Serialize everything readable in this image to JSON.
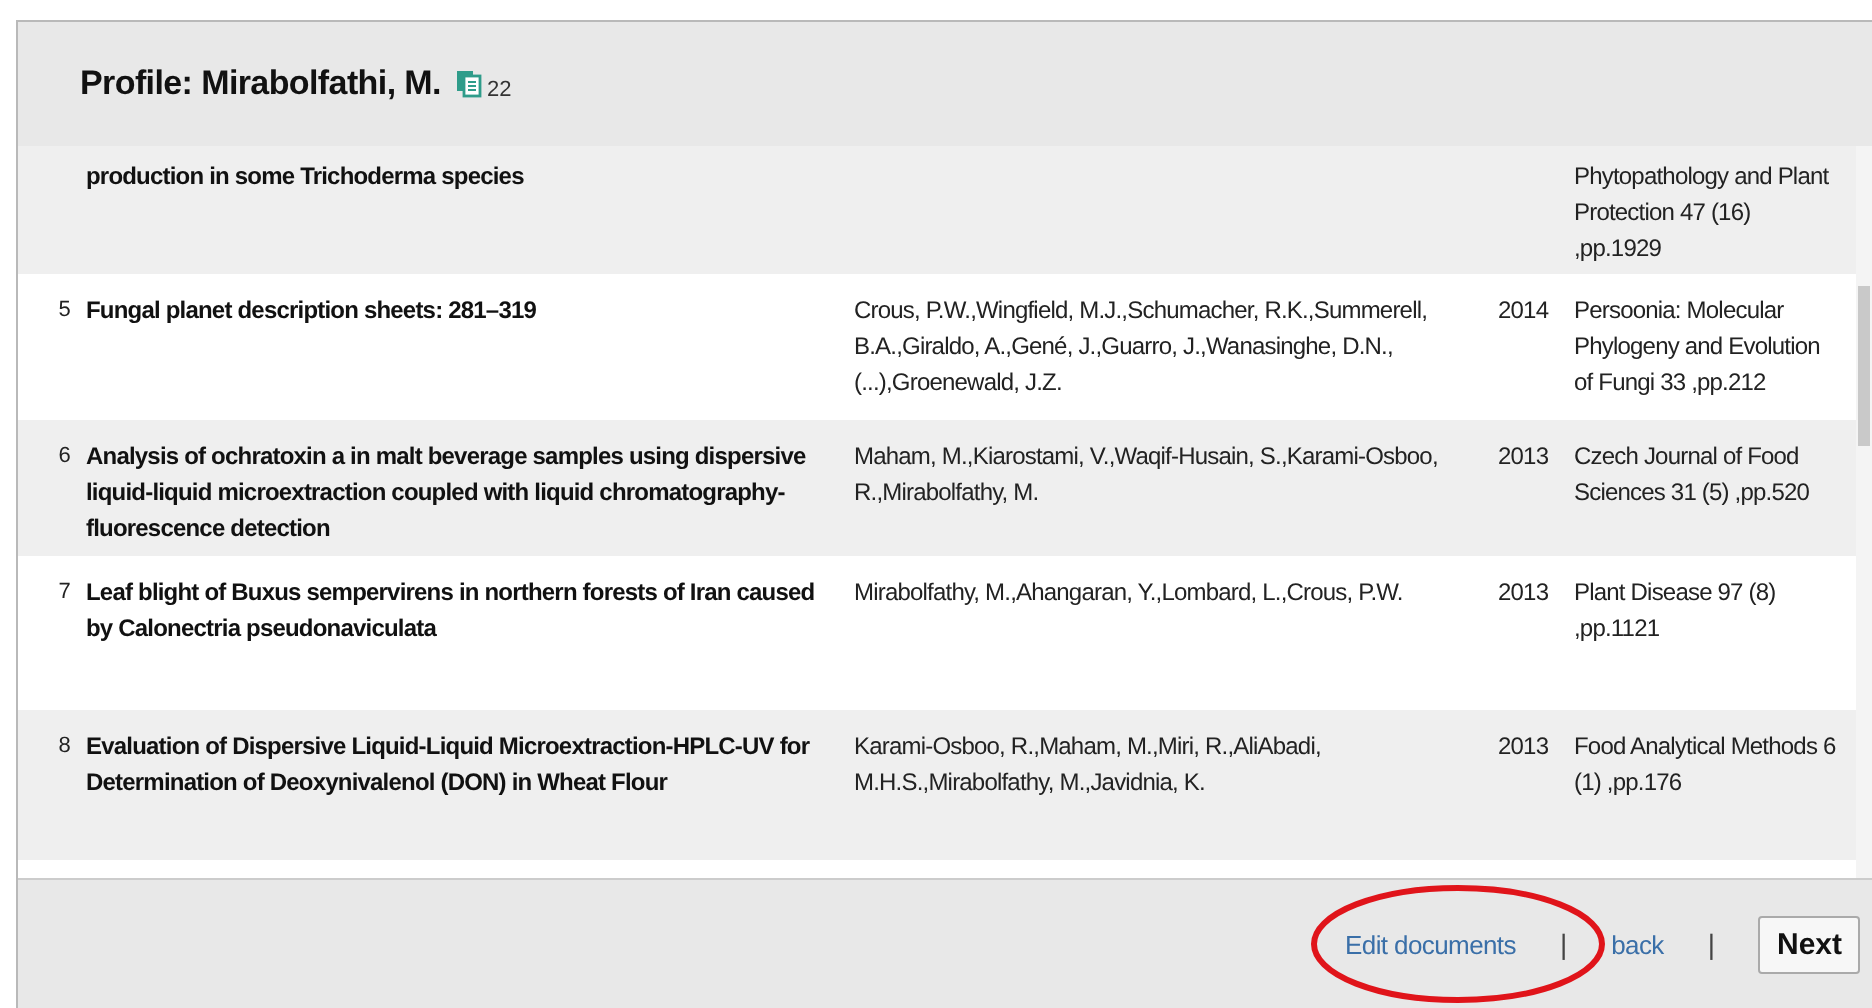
{
  "profile": {
    "title": "Profile: Mirabolfathi, M.",
    "document_count": "22"
  },
  "rows": [
    {
      "number": "",
      "title": "production in some Trichoderma species",
      "authors": "",
      "year": "",
      "source": "Phytopathology and Plant Protection 47 (16) ,pp.1929"
    },
    {
      "number": "5",
      "title": "Fungal planet description sheets: 281–319",
      "authors": "Crous, P.W.,Wingfield, M.J.,Schumacher, R.K.,Summerell, B.A.,Giraldo, A.,Gené, J.,Guarro, J.,Wanasinghe, D.N., (...),Groenewald, J.Z.",
      "year": "2014",
      "source": "Persoonia: Molecular Phylogeny and Evolution of Fungi 33 ,pp.212"
    },
    {
      "number": "6",
      "title": "Analysis of ochratoxin a in malt beverage samples using dispersive liquid-liquid microextraction coupled with liquid chromatography-fluorescence detection",
      "authors": "Maham, M.,Kiarostami, V.,Waqif-Husain, S.,Karami-Osboo, R.,Mirabolfathy, M.",
      "year": "2013",
      "source": "Czech Journal of Food Sciences 31 (5) ,pp.520"
    },
    {
      "number": "7",
      "title": "Leaf blight of Buxus sempervirens in northern forests of Iran caused by Calonectria pseudonaviculata",
      "authors": "Mirabolfathy, M.,Ahangaran, Y.,Lombard, L.,Crous, P.W.",
      "year": "2013",
      "source": "Plant Disease 97 (8) ,pp.1121"
    },
    {
      "number": "8",
      "title": "Evaluation of Dispersive Liquid-Liquid Microextraction-HPLC-UV for Determination of Deoxynivalenol (DON) in Wheat Flour",
      "authors": "Karami-Osboo, R.,Maham, M.,Miri, R.,AliAbadi, M.H.S.,Mirabolfathy, M.,Javidnia, K.",
      "year": "2013",
      "source": "Food Analytical Methods 6 (1) ,pp.176"
    }
  ],
  "footer": {
    "links": [
      "Edit documents",
      "back"
    ],
    "separator": "|",
    "next_button": "Next"
  }
}
